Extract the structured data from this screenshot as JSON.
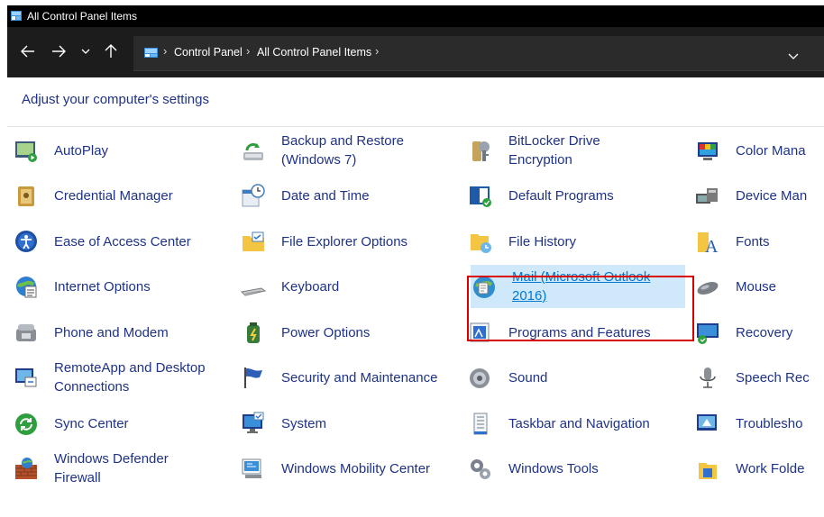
{
  "window": {
    "title": "All Control Panel Items"
  },
  "address_bar": {
    "crumbs": [
      "Control Panel",
      "All Control Panel Items"
    ],
    "sep": "›"
  },
  "heading": "Adjust your computer's settings",
  "items": [
    {
      "label": [
        "AutoPlay"
      ],
      "icon": "autoplay-icon"
    },
    {
      "label": [
        "Backup and Restore",
        "(Windows 7)"
      ],
      "icon": "backup-restore-icon"
    },
    {
      "label": [
        "BitLocker Drive",
        "Encryption"
      ],
      "icon": "bitlocker-icon"
    },
    {
      "label": [
        "Color Mana"
      ],
      "icon": "color-management-icon"
    },
    {
      "label": [
        "Credential Manager"
      ],
      "icon": "credential-manager-icon"
    },
    {
      "label": [
        "Date and Time"
      ],
      "icon": "date-time-icon"
    },
    {
      "label": [
        "Default Programs"
      ],
      "icon": "default-programs-icon"
    },
    {
      "label": [
        "Device Man"
      ],
      "icon": "device-manager-icon"
    },
    {
      "label": [
        "Ease of Access Center"
      ],
      "icon": "ease-of-access-icon"
    },
    {
      "label": [
        "File Explorer Options"
      ],
      "icon": "file-explorer-options-icon"
    },
    {
      "label": [
        "File History"
      ],
      "icon": "file-history-icon"
    },
    {
      "label": [
        "Fonts"
      ],
      "icon": "fonts-icon"
    },
    {
      "label": [
        "Internet Options"
      ],
      "icon": "internet-options-icon"
    },
    {
      "label": [
        "Keyboard"
      ],
      "icon": "keyboard-icon"
    },
    {
      "label": [
        "Mail (Microsoft Outlook",
        "2016)"
      ],
      "icon": "mail-icon",
      "selected": true
    },
    {
      "label": [
        "Mouse"
      ],
      "icon": "mouse-icon"
    },
    {
      "label": [
        "Phone and Modem"
      ],
      "icon": "phone-modem-icon"
    },
    {
      "label": [
        "Power Options"
      ],
      "icon": "power-options-icon"
    },
    {
      "label": [
        "Programs and Features"
      ],
      "icon": "programs-features-icon"
    },
    {
      "label": [
        "Recovery"
      ],
      "icon": "recovery-icon"
    },
    {
      "label": [
        "RemoteApp and Desktop",
        "Connections"
      ],
      "icon": "remoteapp-icon"
    },
    {
      "label": [
        "Security and Maintenance"
      ],
      "icon": "security-maintenance-icon"
    },
    {
      "label": [
        "Sound"
      ],
      "icon": "sound-icon"
    },
    {
      "label": [
        "Speech Rec"
      ],
      "icon": "speech-recognition-icon"
    },
    {
      "label": [
        "Sync Center"
      ],
      "icon": "sync-center-icon"
    },
    {
      "label": [
        "System"
      ],
      "icon": "system-icon"
    },
    {
      "label": [
        "Taskbar and Navigation"
      ],
      "icon": "taskbar-navigation-icon"
    },
    {
      "label": [
        "Troublesho"
      ],
      "icon": "troubleshooting-icon"
    },
    {
      "label": [
        "Windows Defender",
        "Firewall"
      ],
      "icon": "windows-firewall-icon"
    },
    {
      "label": [
        "Windows Mobility Center"
      ],
      "icon": "mobility-center-icon"
    },
    {
      "label": [
        "Windows Tools"
      ],
      "icon": "windows-tools-icon"
    },
    {
      "label": [
        "Work Folde"
      ],
      "icon": "work-folders-icon"
    }
  ],
  "colors": {
    "link": "#1e3287",
    "selected_bg": "#cfe8fa",
    "selected_text": "#0078d4",
    "highlight": "#d90000"
  }
}
